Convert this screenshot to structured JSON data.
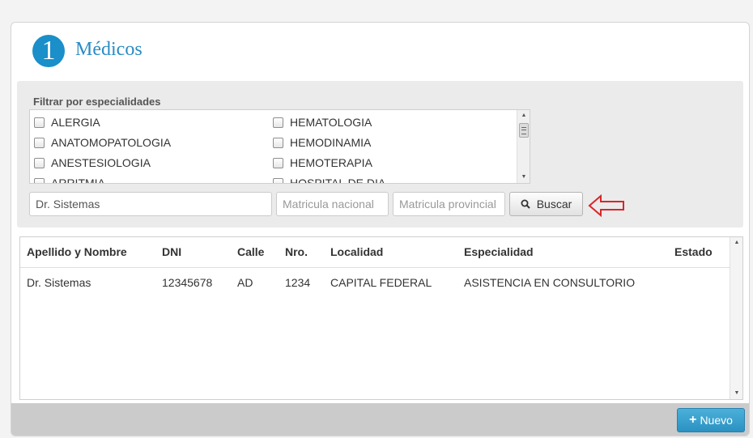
{
  "header": {
    "step_number": "1",
    "title": "Médicos"
  },
  "filters": {
    "specialties_label": "Filtrar por especialidades",
    "specialties": [
      [
        "ALERGIA",
        "HEMATOLOGIA"
      ],
      [
        "ANATOMOPATOLOGIA",
        "HEMODINAMIA"
      ],
      [
        "ANESTESIOLOGIA",
        "HEMOTERAPIA"
      ],
      [
        "ARRITMIA",
        "HOSPITAL DE DIA"
      ]
    ],
    "name_value": "Dr. Sistemas",
    "matricula_nacional_placeholder": "Matricula nacional",
    "matricula_provincial_placeholder": "Matricula provincial",
    "search_label": "Buscar"
  },
  "results": {
    "columns": [
      "Apellido y Nombre",
      "DNI",
      "Calle",
      "Nro.",
      "Localidad",
      "Especialidad",
      "Estado"
    ],
    "rows": [
      [
        "Dr. Sistemas",
        "12345678",
        "AD",
        "1234",
        "CAPITAL FEDERAL",
        "ASISTENCIA EN CONSULTORIO",
        ""
      ]
    ]
  },
  "footer": {
    "new_label": "Nuevo"
  },
  "colors": {
    "accent": "#2a8cc4",
    "arrow": "#d9262b",
    "footer": "#cbcbcb"
  }
}
